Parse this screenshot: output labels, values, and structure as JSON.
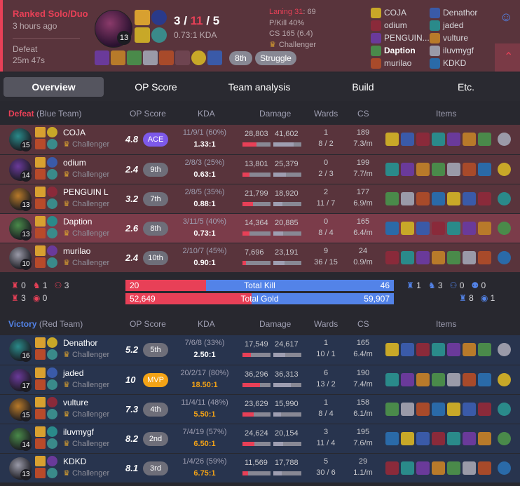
{
  "header": {
    "queue": "Ranked Solo/Duo",
    "ago": "3 hours ago",
    "result": "Defeat",
    "duration": "25m 47s",
    "champ_level": "13",
    "kills": "3",
    "deaths": "11",
    "assists": "5",
    "kda_ratio": "0.73:1 KDA",
    "placement": "8th",
    "tag": "Struggle",
    "laning_label": "Laning 31",
    "laning_value": ": 69",
    "pkill": "P/Kill 40%",
    "cs": "CS 165 (6.4)",
    "tier": "Challenger"
  },
  "players_left": [
    "COJA",
    "odium",
    "PENGUIN...",
    "Daption",
    "murilao"
  ],
  "players_right": [
    "Denathor",
    "jaded",
    "vulture",
    "iluvmygf",
    "KDKD"
  ],
  "tabs": [
    "Overview",
    "OP Score",
    "Team analysis",
    "Build",
    "Etc."
  ],
  "defeat_team": {
    "result": "Defeat",
    "team": "(Blue Team)",
    "cols": [
      "OP Score",
      "KDA",
      "Damage",
      "Wards",
      "CS",
      "Items"
    ],
    "rows": [
      {
        "lvl": "15",
        "name": "COJA",
        "tier": "Challenger",
        "op": "4.8",
        "rank": "ACE",
        "kda": "11/9/1 (60%)",
        "ratio": "1.33:1",
        "dealt": "28,803",
        "taken": "41,602",
        "dealt_pct": 0.5,
        "taken_pct": 0.72,
        "wards": "1",
        "wards2": "8 / 2",
        "cs": "189",
        "csm": "7.3/m"
      },
      {
        "lvl": "14",
        "name": "odium",
        "tier": "Challenger",
        "op": "2.4",
        "rank": "9th",
        "kda": "2/8/3 (25%)",
        "ratio": "0.63:1",
        "dealt": "13,801",
        "taken": "25,379",
        "dealt_pct": 0.24,
        "taken_pct": 0.44,
        "wards": "0",
        "wards2": "2 / 3",
        "cs": "199",
        "csm": "7.7/m"
      },
      {
        "lvl": "13",
        "name": "PENGUIN L",
        "tier": "Challenger",
        "op": "3.2",
        "rank": "7th",
        "kda": "2/8/5 (35%)",
        "ratio": "0.88:1",
        "dealt": "21,799",
        "taken": "18,920",
        "dealt_pct": 0.38,
        "taken_pct": 0.33,
        "wards": "2",
        "wards2": "11 / 7",
        "cs": "177",
        "csm": "6.9/m"
      },
      {
        "lvl": "13",
        "name": "Daption",
        "tier": "Challenger",
        "op": "2.6",
        "rank": "8th",
        "kda": "3/11/5 (40%)",
        "ratio": "0.73:1",
        "dealt": "14,364",
        "taken": "20,885",
        "dealt_pct": 0.25,
        "taken_pct": 0.36,
        "wards": "0",
        "wards2": "8 / 4",
        "cs": "165",
        "csm": "6.4/m"
      },
      {
        "lvl": "10",
        "name": "murilao",
        "tier": "Challenger",
        "op": "2.4",
        "rank": "10th",
        "kda": "2/10/7 (45%)",
        "ratio": "0.90:1",
        "dealt": "7,696",
        "taken": "23,191",
        "dealt_pct": 0.13,
        "taken_pct": 0.4,
        "wards": "9",
        "wards2": "36 / 15",
        "cs": "24",
        "csm": "0.9/m"
      }
    ]
  },
  "summary": {
    "blue_obj": [
      "0",
      "1",
      "3",
      "3",
      "0"
    ],
    "red_obj": [
      "1",
      "3",
      "0",
      "0",
      "8",
      "1"
    ],
    "total_kill_label": "Total Kill",
    "kill_left": "20",
    "kill_right": "46",
    "kill_pct": 0.3,
    "total_gold_label": "Total Gold",
    "gold_left": "52,649",
    "gold_right": "59,907",
    "gold_pct": 0.47
  },
  "victory_team": {
    "result": "Victory",
    "team": "(Red Team)",
    "cols": [
      "OP Score",
      "KDA",
      "Damage",
      "Wards",
      "CS",
      "Items"
    ],
    "rows": [
      {
        "lvl": "16",
        "name": "Denathor",
        "tier": "Challenger",
        "op": "5.2",
        "rank": "5th",
        "kda": "7/6/8 (33%)",
        "ratio": "2.50:1",
        "dealt": "17,549",
        "taken": "24,617",
        "dealt_pct": 0.3,
        "taken_pct": 0.43,
        "wards": "1",
        "wards2": "10 / 1",
        "cs": "165",
        "csm": "6.4/m"
      },
      {
        "lvl": "17",
        "name": "jaded",
        "tier": "Challenger",
        "op": "10",
        "rank": "MVP",
        "kda": "20/2/17 (80%)",
        "ratio": "18.50:1",
        "dealt": "36,296",
        "taken": "36,313",
        "dealt_pct": 0.63,
        "taken_pct": 0.63,
        "wards": "6",
        "wards2": "13 / 2",
        "cs": "190",
        "csm": "7.4/m"
      },
      {
        "lvl": "15",
        "name": "vulture",
        "tier": "Challenger",
        "op": "7.3",
        "rank": "4th",
        "kda": "11/4/11 (48%)",
        "ratio": "5.50:1",
        "dealt": "23,629",
        "taken": "15,990",
        "dealt_pct": 0.41,
        "taken_pct": 0.28,
        "wards": "1",
        "wards2": "8 / 4",
        "cs": "158",
        "csm": "6.1/m"
      },
      {
        "lvl": "14",
        "name": "iluvmygf",
        "tier": "Challenger",
        "op": "8.2",
        "rank": "2nd",
        "kda": "7/4/19 (57%)",
        "ratio": "6.50:1",
        "dealt": "24,624",
        "taken": "20,154",
        "dealt_pct": 0.43,
        "taken_pct": 0.35,
        "wards": "3",
        "wards2": "11 / 4",
        "cs": "195",
        "csm": "7.6/m"
      },
      {
        "lvl": "13",
        "name": "KDKD",
        "tier": "Challenger",
        "op": "8.1",
        "rank": "3rd",
        "kda": "1/4/26 (59%)",
        "ratio": "6.75:1",
        "dealt": "11,569",
        "taken": "17,788",
        "dealt_pct": 0.2,
        "taken_pct": 0.31,
        "wards": "5",
        "wards2": "30 / 6",
        "cs": "29",
        "csm": "1.1/m"
      }
    ]
  },
  "colors": {
    "red": "#e84057",
    "blue": "#5383e8",
    "ace": "#7d59ea",
    "mvp": "#f4a316",
    "gold": "#f4a316"
  }
}
